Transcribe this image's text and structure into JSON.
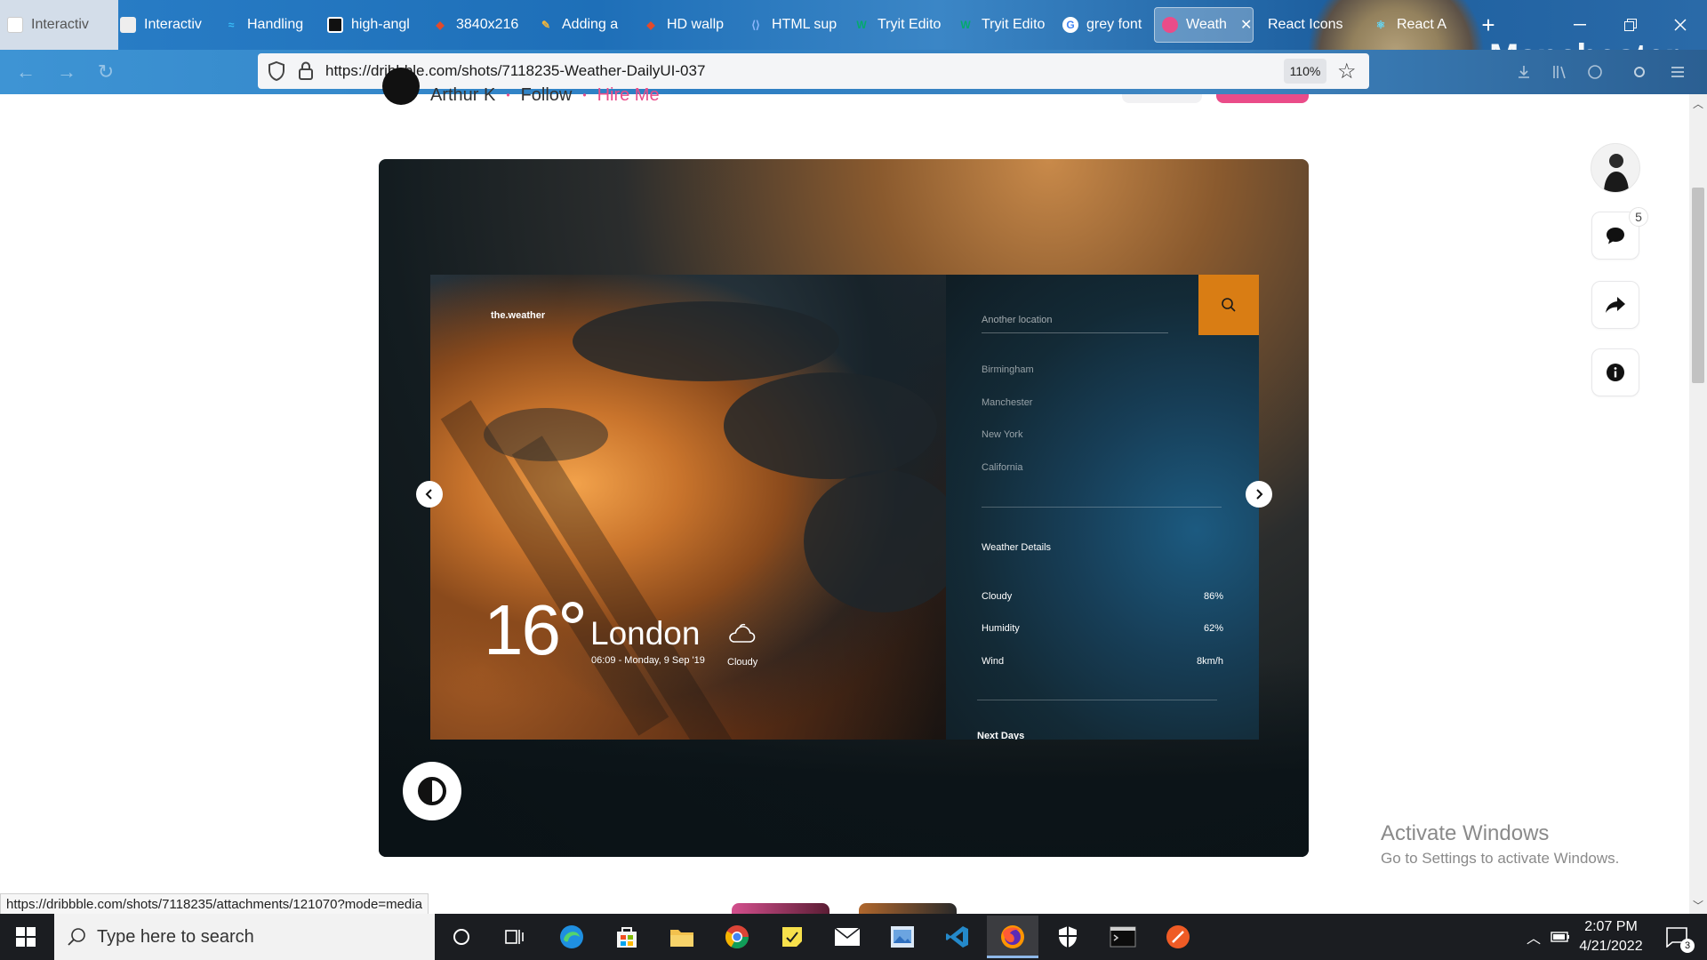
{
  "browser": {
    "tabs": [
      {
        "label": "Interactiv",
        "favicon_color": "#d0d3d8"
      },
      {
        "label": "Interactiv",
        "favicon_color": "#eeeeee"
      },
      {
        "label": "Handling",
        "favicon_color": "#38bdf8"
      },
      {
        "label": "high-angl",
        "favicon_color": "#111111"
      },
      {
        "label": "3840x216",
        "favicon_color": "#e24a2b"
      },
      {
        "label": "Adding a",
        "favicon_color": "#f2b53a"
      },
      {
        "label": "HD wallp",
        "favicon_color": "#e24a2b"
      },
      {
        "label": "HTML sup",
        "favicon_color": "#2a6cc8"
      },
      {
        "label": "Tryit Edito",
        "favicon_color": "#04aa6d"
      },
      {
        "label": "Tryit Edito",
        "favicon_color": "#04aa6d"
      },
      {
        "label": "grey font",
        "favicon_color": "#4285f4"
      },
      {
        "label": "Weath",
        "favicon_color": "#ea4c89"
      },
      {
        "label": "React Icons",
        "favicon_color": "#e94c6b"
      },
      {
        "label": "React A",
        "favicon_color": "#61dafb"
      }
    ],
    "active_tab_index": 11,
    "background_text": "Manchester City",
    "url": "https://dribbble.com/shots/7118235-Weather-DailyUI-037",
    "zoom": "110%",
    "status_url": "https://dribbble.com/shots/7118235/attachments/121070?mode=media"
  },
  "page": {
    "author": "Arthur K",
    "follow": "Follow",
    "hire": "Hire Me",
    "comment_count": "5"
  },
  "shot": {
    "brand": "the.weather",
    "temperature": "16",
    "city": "London",
    "datetime": "06:09 - Monday, 9 Sep '19",
    "condition": "Cloudy",
    "search_placeholder": "Another location",
    "locations": [
      "Birmingham",
      "Manchester",
      "New York",
      "California"
    ],
    "details_title": "Weather Details",
    "details": [
      {
        "label": "Cloudy",
        "value": "86%"
      },
      {
        "label": "Humidity",
        "value": "62%"
      },
      {
        "label": "Wind",
        "value": "8km/h"
      }
    ],
    "next_days": "Next Days",
    "accent_color": "#d97d14"
  },
  "watermark": {
    "line1": "Activate Windows",
    "line2": "Go to Settings to activate Windows."
  },
  "taskbar": {
    "search_placeholder": "Type here to search",
    "time": "2:07 PM",
    "date": "4/21/2022",
    "notification_count": "3"
  }
}
